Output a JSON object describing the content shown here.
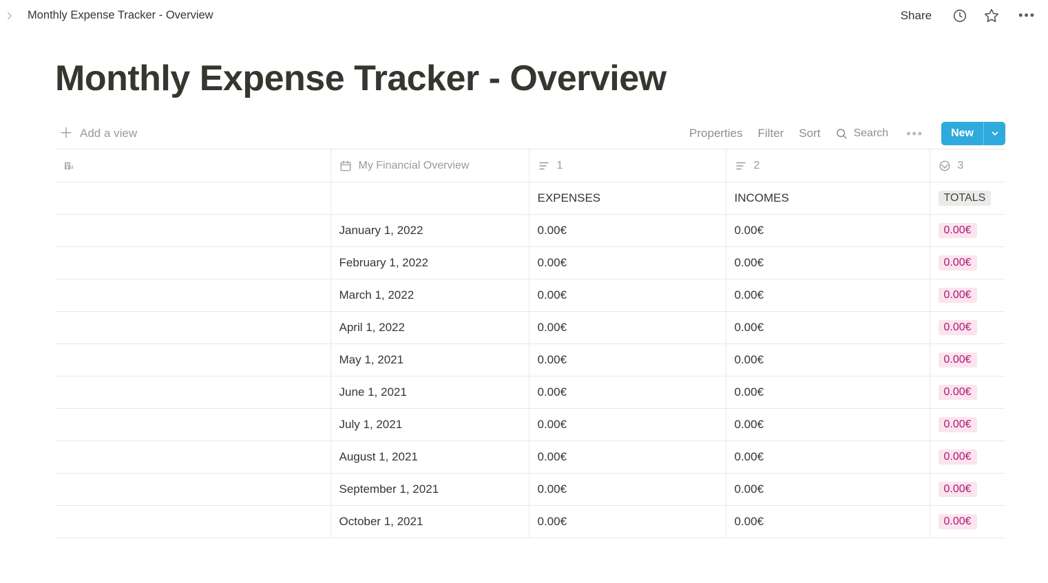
{
  "topbar": {
    "breadcrumb": "Monthly Expense Tracker - Overview",
    "share": "Share"
  },
  "page": {
    "title": "Monthly Expense Tracker - Overview"
  },
  "toolbar": {
    "add_view": "Add a view",
    "properties": "Properties",
    "filter": "Filter",
    "sort": "Sort",
    "search": "Search",
    "new": "New"
  },
  "columns": {
    "title": "",
    "date": "My Financial Overview",
    "c1": "1",
    "c2": "2",
    "c3": "3"
  },
  "header_row": {
    "title": "",
    "date": "",
    "c1": "EXPENSES",
    "c2": "INCOMES",
    "c3": "TOTALS"
  },
  "rows": [
    {
      "title": "",
      "date": "January 1, 2022",
      "c1": "0.00€",
      "c2": "0.00€",
      "c3": "0.00€"
    },
    {
      "title": "",
      "date": "February 1, 2022",
      "c1": "0.00€",
      "c2": "0.00€",
      "c3": "0.00€"
    },
    {
      "title": "",
      "date": "March 1, 2022",
      "c1": "0.00€",
      "c2": "0.00€",
      "c3": "0.00€"
    },
    {
      "title": "",
      "date": "April 1, 2022",
      "c1": "0.00€",
      "c2": "0.00€",
      "c3": "0.00€"
    },
    {
      "title": "",
      "date": "May 1, 2021",
      "c1": "0.00€",
      "c2": "0.00€",
      "c3": "0.00€"
    },
    {
      "title": "",
      "date": "June 1, 2021",
      "c1": "0.00€",
      "c2": "0.00€",
      "c3": "0.00€"
    },
    {
      "title": "",
      "date": "July 1, 2021",
      "c1": "0.00€",
      "c2": "0.00€",
      "c3": "0.00€"
    },
    {
      "title": "",
      "date": "August 1, 2021",
      "c1": "0.00€",
      "c2": "0.00€",
      "c3": "0.00€"
    },
    {
      "title": "",
      "date": "September 1, 2021",
      "c1": "0.00€",
      "c2": "0.00€",
      "c3": "0.00€"
    },
    {
      "title": "",
      "date": "October 1, 2021",
      "c1": "0.00€",
      "c2": "0.00€",
      "c3": "0.00€"
    }
  ]
}
